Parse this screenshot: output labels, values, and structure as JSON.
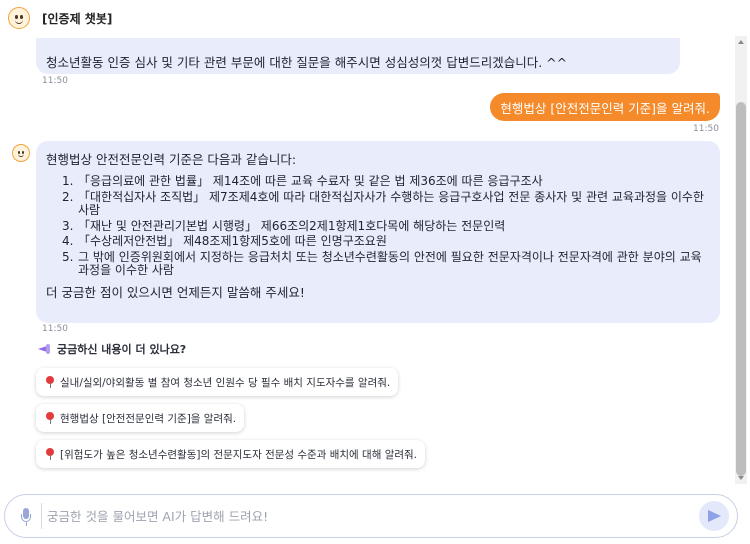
{
  "header": {
    "title": "[인증제 챗봇]"
  },
  "messages": {
    "prev_bot": {
      "text": "청소년활동 인증 심사 및 기타 관련 부문에 대한 질문을 해주시면 성심성의껏 답변드리겠습니다. ^^",
      "time": "11:50"
    },
    "user": {
      "text": "현행법상 [안전전문인력 기준]을 알려줘.",
      "time": "11:50"
    },
    "answer": {
      "intro": "현행법상 안전전문인력 기준은 다음과 같습니다:",
      "items": [
        {
          "num": "1.",
          "text": "「응급의료에 관한 법률」 제14조에 따른 교육 수료자 및 같은 법 제36조에 따른 응급구조사"
        },
        {
          "num": "2.",
          "text": "「대한적십자사 조직법」 제7조제4호에 따라 대한적십자사가 수행하는 응급구호사업 전문 종사자 및 관련 교육과정을 이수한 사람"
        },
        {
          "num": "3.",
          "text": "「재난 및 안전관리기본법 시행령」 제66조의2제1항제1호다목에 해당하는 전문인력"
        },
        {
          "num": "4.",
          "text": "「수상레저안전법」 제48조제1항제5호에 따른 인명구조요원"
        },
        {
          "num": "5.",
          "text": "그 밖에 인증위원회에서 지정하는 응급처치 또는 청소년수련활동의 안전에 필요한 전문자격이나 전문자격에 관한 분야의 교육과정을 이수한 사람"
        }
      ],
      "outro": "더 궁금한 점이 있으시면 언제든지 말씀해 주세요!",
      "time": "11:50"
    }
  },
  "suggestions": {
    "title": "궁금하신 내용이 더 있나요?",
    "items": [
      "실내/실외/야외활동 별 참여 청소년 인원수 당 필수 배치 지도자수를 알려줘.",
      "현행법상 [안전전문인력 기준]을 알려줘.",
      "[위험도가 높은 청소년수련활동]의 전문지도자 전문성 수준과 배치에 대해 알려줘."
    ]
  },
  "composer": {
    "placeholder": "궁금한 것을 물어보면 AI가 답변해 드려요!",
    "value": ""
  },
  "colors": {
    "accent": "#f58a2a",
    "bot_bubble": "#e9ecfb",
    "send": "#8fa1e6"
  },
  "icons": {
    "bot": "bot-face-icon",
    "megaphone": "megaphone-icon",
    "pin": "pushpin-icon",
    "mic": "mic-icon",
    "send": "send-icon"
  }
}
